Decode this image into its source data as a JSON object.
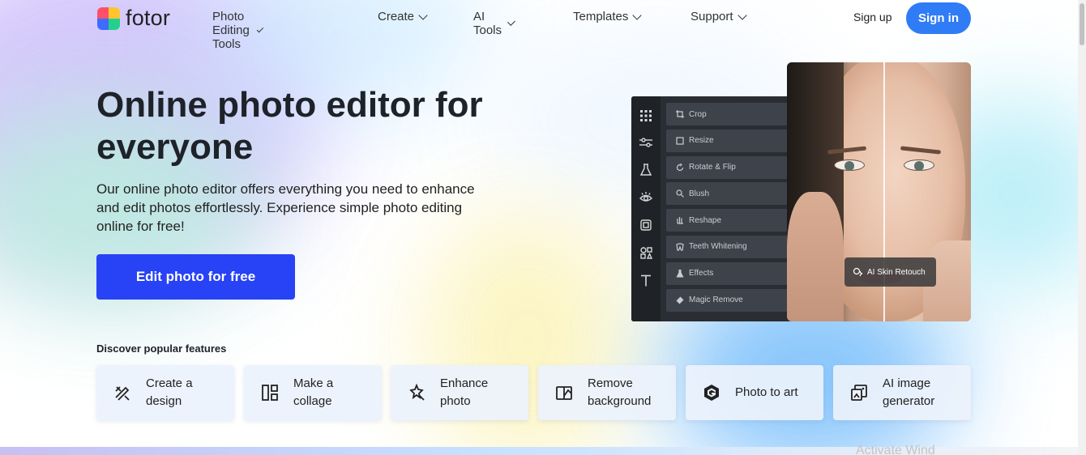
{
  "nav": {
    "logo_text": "fotor",
    "menu": [
      {
        "label": "Photo Editing Tools"
      },
      {
        "label": "Create"
      },
      {
        "label": "AI Tools"
      },
      {
        "label": "Templates"
      },
      {
        "label": "Support"
      }
    ],
    "signup_label": "Sign up",
    "signin_label": "Sign in"
  },
  "hero": {
    "title_line1": "Online photo editor for",
    "title_line2": "everyone",
    "description_line1": "Our online photo editor offers everything you need to enhance",
    "description_line2": "and edit photos effortlessly. Experience simple photo editing",
    "description_line3": "online for free!",
    "cta_label": "Edit photo for free"
  },
  "editor": {
    "tools": [
      {
        "label": "Crop",
        "icon": "crop-icon"
      },
      {
        "label": "Resize",
        "icon": "resize-icon"
      },
      {
        "label": "Rotate & Flip",
        "icon": "rotate-icon"
      },
      {
        "label": "Blush",
        "icon": "blush-icon"
      },
      {
        "label": "Reshape",
        "icon": "reshape-icon"
      },
      {
        "label": "Teeth Whitening",
        "icon": "teeth-icon"
      },
      {
        "label": "Effects",
        "icon": "effects-icon"
      },
      {
        "label": "Magic Remove",
        "icon": "eraser-icon"
      }
    ],
    "badge_label": "AI Skin Retouch"
  },
  "features": {
    "title": "Discover popular features",
    "items": [
      {
        "line1": "Create a",
        "line2": "design",
        "icon": "design-icon"
      },
      {
        "line1": "Make a",
        "line2": "collage",
        "icon": "collage-icon"
      },
      {
        "line1": "Enhance",
        "line2": "photo",
        "icon": "enhance-icon"
      },
      {
        "line1": "Remove",
        "line2": "background",
        "icon": "remove-bg-icon"
      },
      {
        "line1": "Photo to art",
        "line2": "",
        "icon": "photo-to-art-icon"
      },
      {
        "line1": "AI image",
        "line2": "generator",
        "icon": "ai-image-icon"
      }
    ]
  },
  "watermark": "Activate Wind",
  "colors": {
    "accent": "#2842f5",
    "signin": "#2f7cf6",
    "editor_panel": "#2a2d33"
  }
}
